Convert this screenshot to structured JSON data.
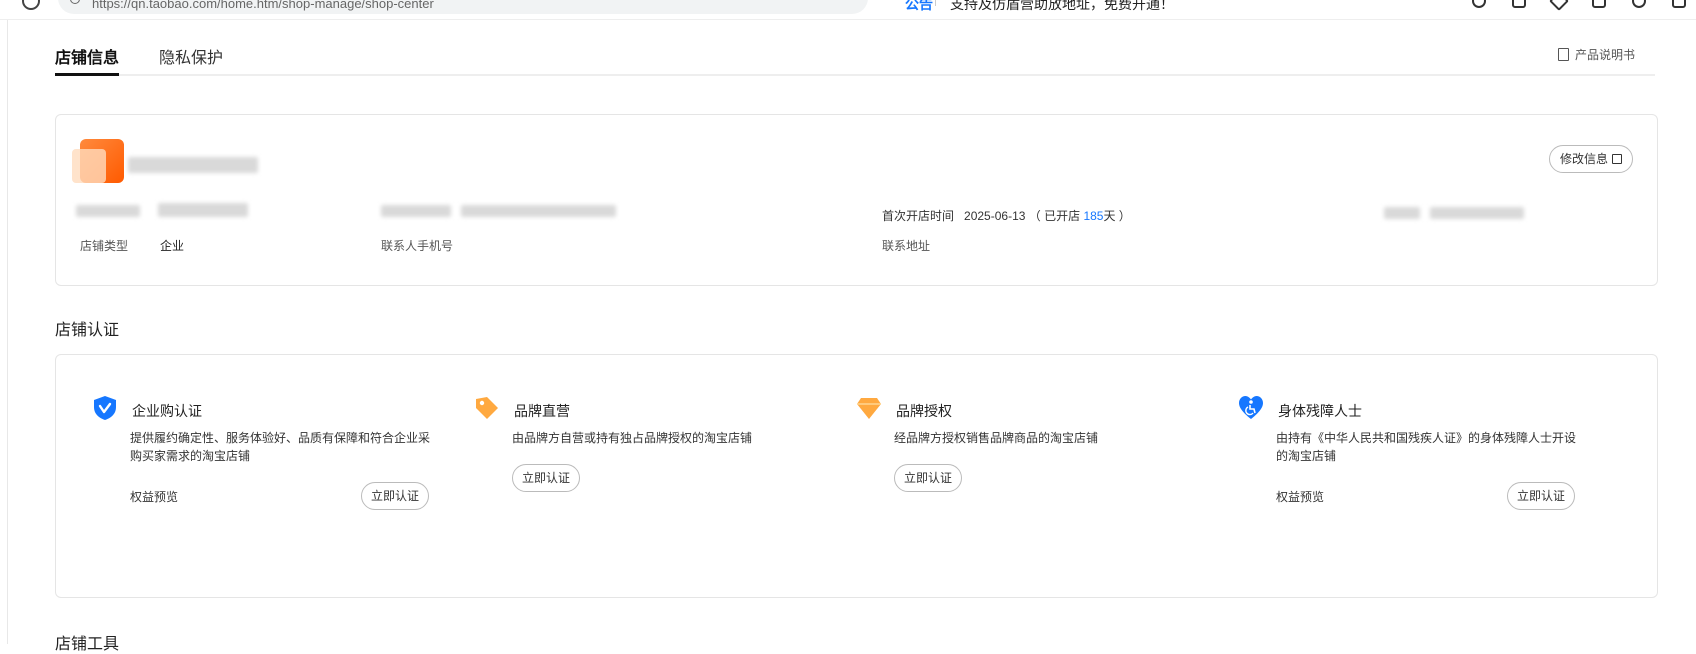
{
  "browser": {
    "url": "https://qn.taobao.com/home.htm/shop-manage/shop-center",
    "notice_tag": "公告",
    "notice_text": "支持及仿盾营助放地址，免费开通！"
  },
  "tabs": [
    {
      "label": "店铺信息",
      "active": true
    },
    {
      "label": "隐私保护",
      "active": false
    }
  ],
  "manual_label": "产品说明书",
  "shop_info": {
    "edit_label": "修改信息",
    "open_date_label": "首次开店时间",
    "open_date": "2025-06-13",
    "open_days_prefix": "（ 已开店 ",
    "open_days": "185",
    "open_days_suffix": "天 ）",
    "shop_type_label": "店铺类型",
    "shop_type_value": "企业",
    "contact_phone_label": "联系人手机号",
    "contact_address_label": "联系地址"
  },
  "certification": {
    "title": "店铺认证",
    "items": [
      {
        "title": "企业购认证",
        "desc": "提供履约确定性、服务体验好、品质有保障和符合企业采购买家需求的淘宝店铺",
        "link": "权益预览",
        "button": "立即认证",
        "color": "#1677ff",
        "icon": "shield-icon"
      },
      {
        "title": "品牌直营",
        "desc": "由品牌方自营或持有独占品牌授权的淘宝店铺",
        "link": "",
        "button": "立即认证",
        "color": "#ffa940",
        "icon": "tag-icon"
      },
      {
        "title": "品牌授权",
        "desc": "经品牌方授权销售品牌商品的淘宝店铺",
        "link": "",
        "button": "立即认证",
        "color": "#ffa940",
        "icon": "diamond-icon"
      },
      {
        "title": "身体残障人士",
        "desc": "由持有《中华人民共和国残疾人证》的身体残障人士开设的淘宝店铺",
        "link": "权益预览",
        "button": "立即认证",
        "color": "#1677ff",
        "icon": "accessibility-heart-icon"
      }
    ]
  },
  "tools_title": "店铺工具"
}
